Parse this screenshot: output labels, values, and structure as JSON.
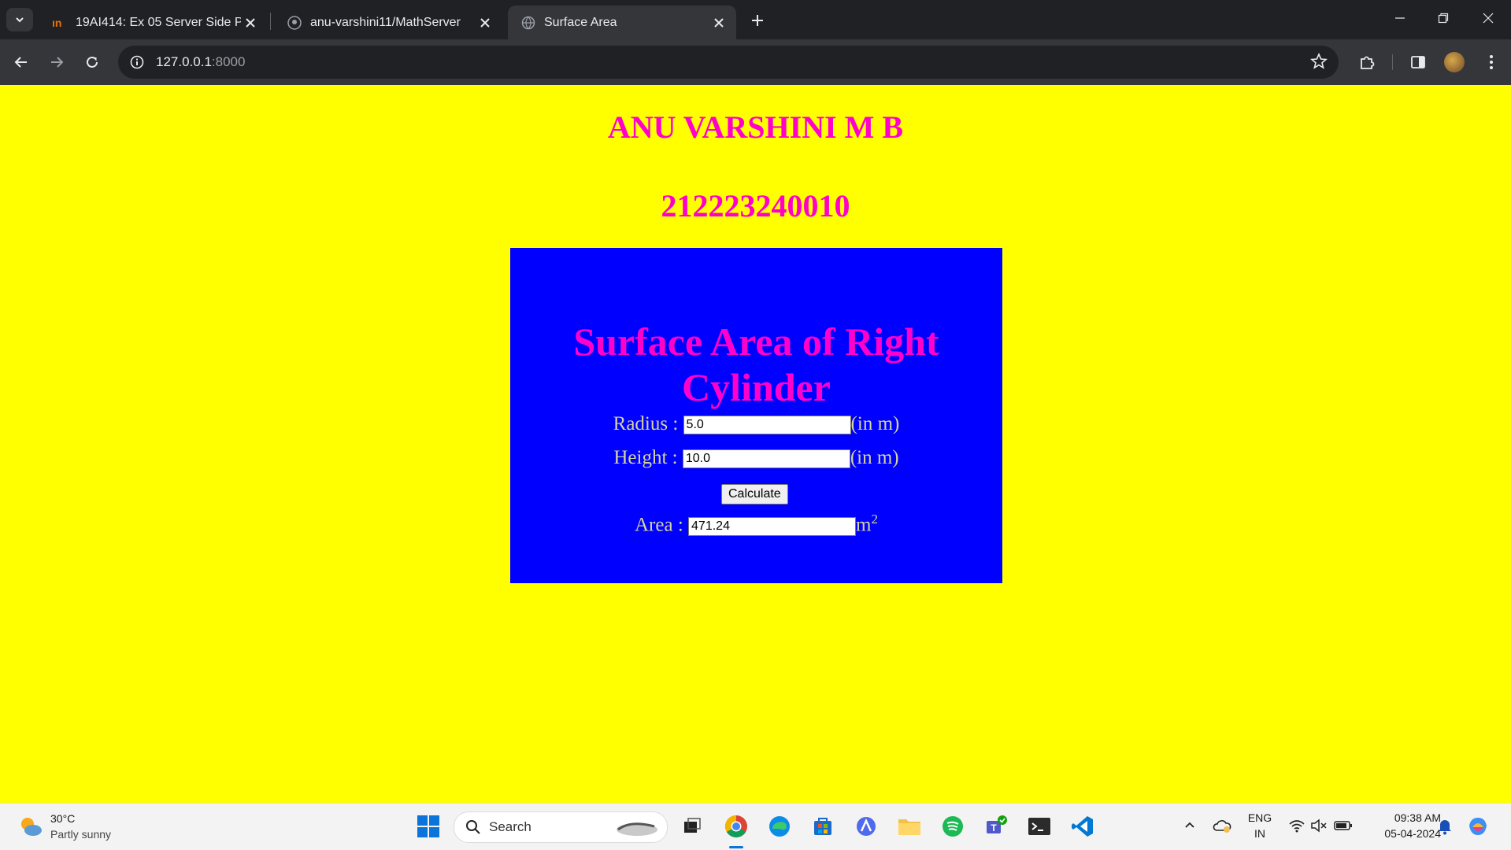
{
  "browser": {
    "tabs": [
      {
        "title": "19AI414: Ex 05 Server Side Proc"
      },
      {
        "title": "anu-varshini11/MathServer"
      },
      {
        "title": "Surface Area"
      }
    ],
    "url_host": "127.0.0.1",
    "url_port": ":8000"
  },
  "page": {
    "name": "ANU VARSHINI M B",
    "roll": "212223240010",
    "form": {
      "title": "Surface Area of Right Cylinder",
      "radius_label": "Radius :",
      "radius_value": "5.0",
      "radius_unit": "(in m)",
      "height_label": "Height :",
      "height_value": "10.0",
      "height_unit": "(in m)",
      "button": "Calculate",
      "area_label": "Area :",
      "area_value": "471.24",
      "area_unit": "m",
      "area_unit_sup": "2"
    },
    "colors": {
      "background": "#ffff00",
      "box": "#0000ff",
      "heading": "#ff00cc"
    }
  },
  "taskbar": {
    "weather_temp": "30°C",
    "weather_desc": "Partly sunny",
    "search_label": "Search",
    "lang_top": "ENG",
    "lang_bottom": "IN",
    "time": "09:38 AM",
    "date": "05-04-2024"
  }
}
